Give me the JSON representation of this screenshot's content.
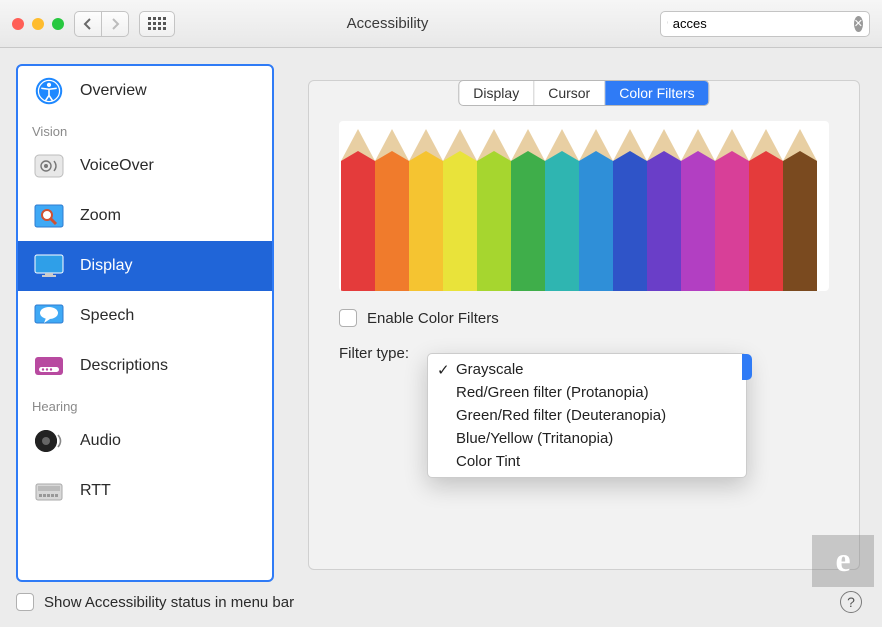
{
  "window": {
    "title": "Accessibility"
  },
  "search": {
    "value": "acces",
    "placeholder": ""
  },
  "sidebar": {
    "topItem": {
      "label": "Overview"
    },
    "groups": [
      {
        "header": "Vision",
        "items": [
          {
            "label": "VoiceOver"
          },
          {
            "label": "Zoom"
          },
          {
            "label": "Display",
            "selected": true
          },
          {
            "label": "Speech"
          },
          {
            "label": "Descriptions"
          }
        ]
      },
      {
        "header": "Hearing",
        "items": [
          {
            "label": "Audio"
          },
          {
            "label": "RTT"
          }
        ]
      }
    ]
  },
  "tabs": {
    "items": [
      "Display",
      "Cursor",
      "Color Filters"
    ],
    "active": 2
  },
  "enableFilters": {
    "label": "Enable Color Filters",
    "checked": false
  },
  "filterType": {
    "label": "Filter type:"
  },
  "dropdown": {
    "selectedIndex": 0,
    "options": [
      "Grayscale",
      "Red/Green filter (Protanopia)",
      "Green/Red filter (Deuteranopia)",
      "Blue/Yellow (Tritanopia)",
      "Color Tint"
    ]
  },
  "pencilColors": [
    "#e43b3b",
    "#f07b2c",
    "#f5c431",
    "#e9e33a",
    "#a6d62f",
    "#3fae4a",
    "#2fb5b1",
    "#2f8fd8",
    "#2f54c8",
    "#6a3ec8",
    "#b23fc2",
    "#d83f98",
    "#e43b3b",
    "#7a4a1f"
  ],
  "footer": {
    "label": "Show Accessibility status in menu bar",
    "checked": false
  },
  "badge": {
    "text": "e"
  }
}
